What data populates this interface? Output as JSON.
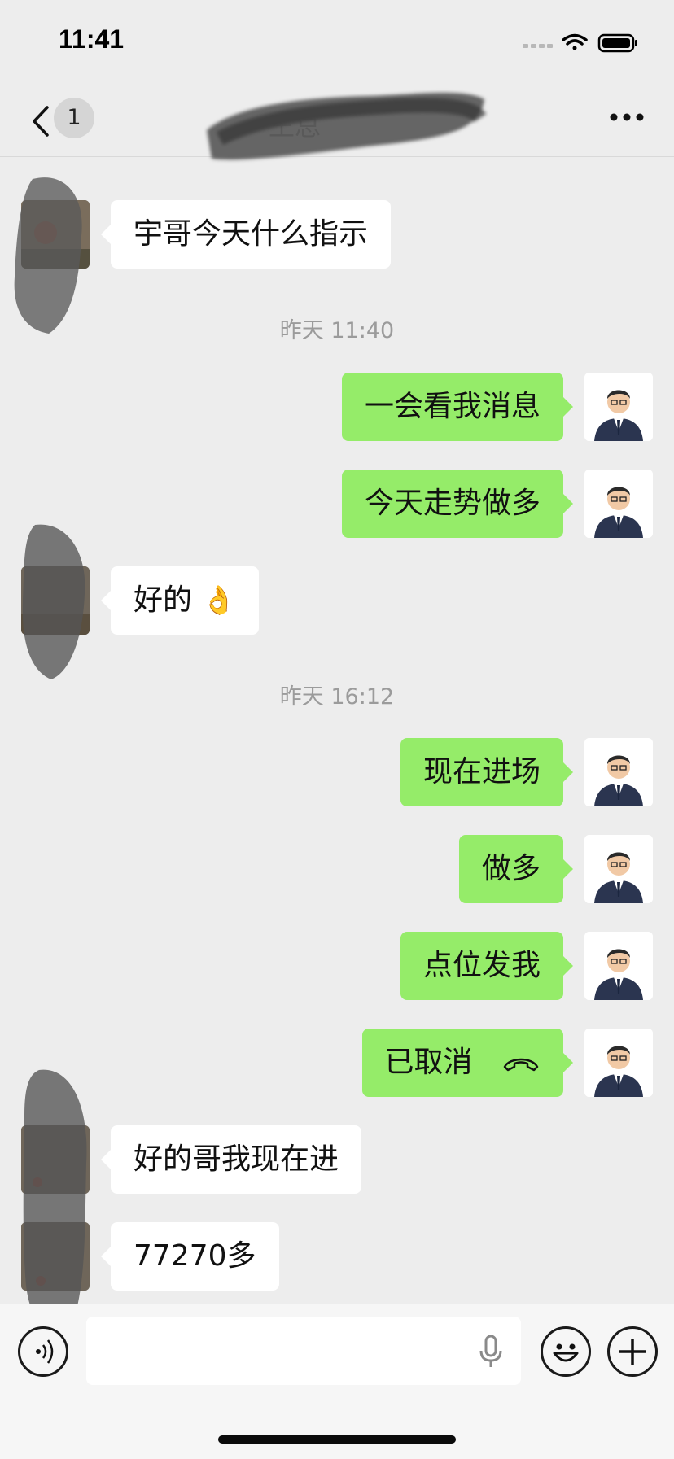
{
  "status_bar": {
    "time": "11:41"
  },
  "nav": {
    "unread_count": "1",
    "contact_name": "王总"
  },
  "timestamps": [
    "昨天 11:40",
    "昨天 16:12"
  ],
  "messages": [
    {
      "side": "left",
      "text": "宇哥今天什么指示"
    },
    {
      "side": "right",
      "text": "一会看我消息"
    },
    {
      "side": "right",
      "text": "今天走势做多"
    },
    {
      "side": "left",
      "text": "好的",
      "emoji": "👌"
    },
    {
      "side": "right",
      "text": "现在进场"
    },
    {
      "side": "right",
      "text": "做多"
    },
    {
      "side": "right",
      "text": "点位发我"
    },
    {
      "side": "right",
      "text": "已取消",
      "icon": "hangup-icon"
    },
    {
      "side": "left",
      "text": "好的哥我现在进"
    },
    {
      "side": "left",
      "text": "77270多"
    }
  ],
  "colors": {
    "background": "#ededed",
    "my_bubble": "#95ec69",
    "their_bubble": "#ffffff"
  }
}
